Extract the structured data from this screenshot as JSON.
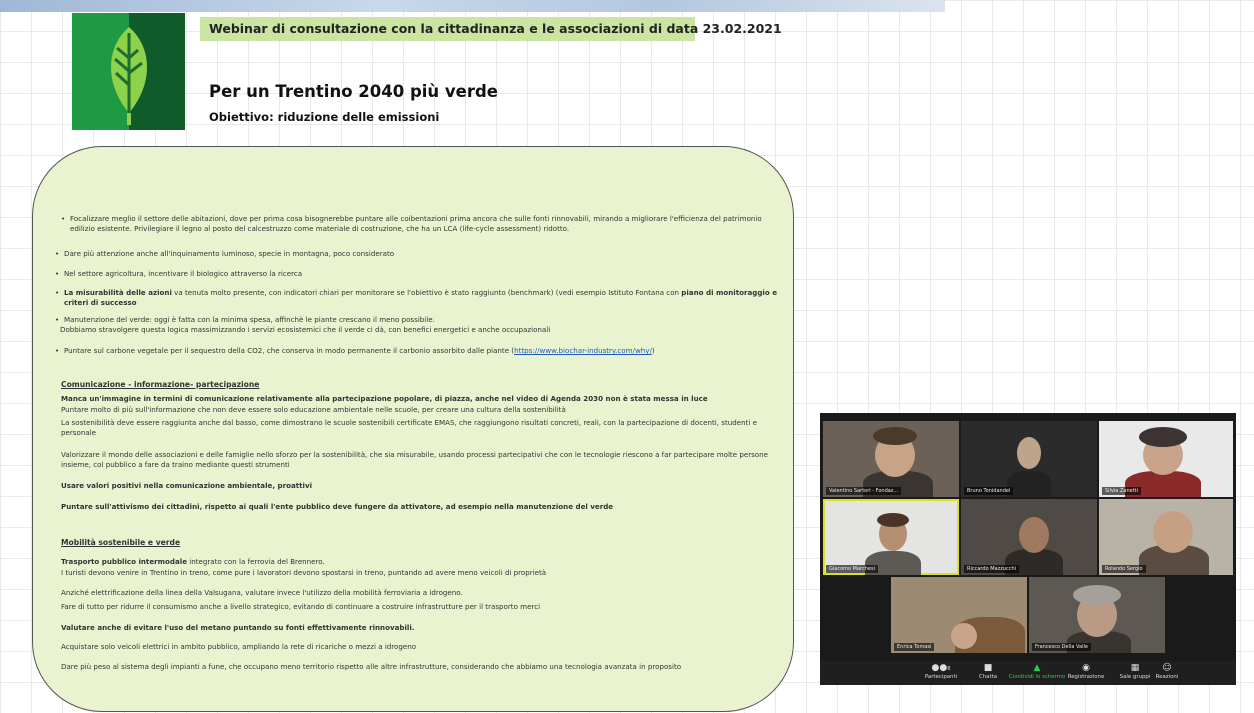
{
  "header": {
    "banner": "Webinar di consultazione con la cittadinanza e le associazioni di data 23.02.2021",
    "title": "Per un Trentino 2040 più verde",
    "subtitle": "Obiettivo: riduzione delle emissioni"
  },
  "bullets": [
    {
      "pre": "",
      "bold": "",
      "text": "Focalizzare meglio il settore delle abitazioni, dove per prima cosa bisognerebbe puntare alle coibentazioni prima ancora che sulle fonti rinnovabili, mirando a migliorare l'efficienza del patrimonio edilizio esistente. Privilegiare il legno al posto del calcestruzzo come materiale di costruzione, che ha un LCA (life-cycle assessment) ridotto."
    },
    {
      "text": "Dare più attenzione anche all'inquinamento luminoso, specie in montagna, poco considerato"
    },
    {
      "text": "Nel settore agricoltura, incentivare il biologico attraverso la ricerca"
    },
    {
      "bold": "La misurabilità delle azioni",
      "text": " va tenuta molto presente, con indicatori chiari per monitorare se l'obiettivo è stato raggiunto (benchmark) (vedi esempio Istituto Fontana con ",
      "bold2": "piano di monitoraggio e criteri di successo"
    },
    {
      "text": "Manutenzione del verde: oggi è fatta con la minima spesa, affinchè le piante crescano il meno possibile.",
      "text2": "Dobbiamo stravolgere questa logica massimizzando i servizi ecosistemici che il verde ci dà, con benefici energetici e anche occupazionali"
    },
    {
      "text": "Puntare sul carbone vegetale per il sequestro della CO2, che conserva in modo permanente il carbonio assorbito dalle piante (",
      "link": "https://www.biochar-industry.com/why/",
      "after": ")"
    }
  ],
  "section1": {
    "heading": "Comunicazione - informazione- partecipazione",
    "lines": [
      "Manca un'immagine in termini di comunicazione relativamente alla partecipazione popolare, di piazza, anche nel video di Agenda 2030 non è stata messa in luce",
      "Puntare molto di più sull'informazione che non deve essere solo educazione ambientale nelle scuole, per creare una cultura della sostenibilità",
      "La sostenibilità deve essere raggiunta anche dal basso, come dimostrano le scuole sostenibili certificate EMAS, che raggiungono risultati concreti, reali, con la partecipazione di docenti, studenti e personale",
      "Valorizzare il mondo delle associazioni e delle famiglie nello sforzo per la sostenibilità, che sia misurabile, usando processi partecipativi che con le tecnologie riescono a far partecipare molte persone insieme, col pubblico a fare da traino mediante questi strumenti",
      "Usare valori positivi nella comunicazione ambientale, proattivi",
      "Puntare sull'attivismo dei cittadini, rispetto ai quali l'ente pubblico deve fungere da attivatore, ad esempio nella manutenzione del verde"
    ]
  },
  "section2": {
    "heading": "Mobilità sostenibile e verde",
    "lines": [
      {
        "bold": "Trasporto pubblico intermodale",
        "text": " integrato con la ferrovia del Brennero."
      },
      {
        "text": "I turisti devono venire in Trentino in treno, come pure i lavoratori devono spostarsi in treno, puntando ad avere meno veicoli di proprietà"
      },
      {
        "text": "Anziché elettrificazione della linea della Valsugana, valutare invece l'utilizzo della mobilità ferroviaria a idrogeno."
      },
      {
        "text": "Fare di tutto per ridurre il consumismo anche a livello strategico, evitando di continuare a costruire infrastrutture per il trasporto merci"
      },
      {
        "bold": "Valutare anche di evitare l'uso del metano puntando su fonti effettivamente rinnovabili."
      },
      {
        "text": "Acquistare solo veicoli elettrici in ambito pubblico, ampliando la rete di ricariche o mezzi a idrogeno"
      },
      {
        "text": "Dare più peso al sistema degli impianti a fune, che occupano meno territorio rispetto alle altre infrastrutture, considerando che abbiamo una tecnologia avanzata in proposito"
      }
    ]
  },
  "zoom": {
    "participants": [
      "Valentino Sartori - Fondaz...",
      "Bruno Tonidandel",
      "Silvia Zanetti",
      "Giacomo Marchesi",
      "Riccardo Mazzucchi",
      "Rolando Sergio",
      "Enrica Tomasi",
      "Francesco Della Valle"
    ],
    "participant_count": "8",
    "toolbar": {
      "participants": "Partecipanti",
      "chat": "Chatta",
      "share": "Condividi lo schermo",
      "record": "Registrazione",
      "rooms": "Sale gruppi",
      "reactions": "Reazioni"
    }
  }
}
